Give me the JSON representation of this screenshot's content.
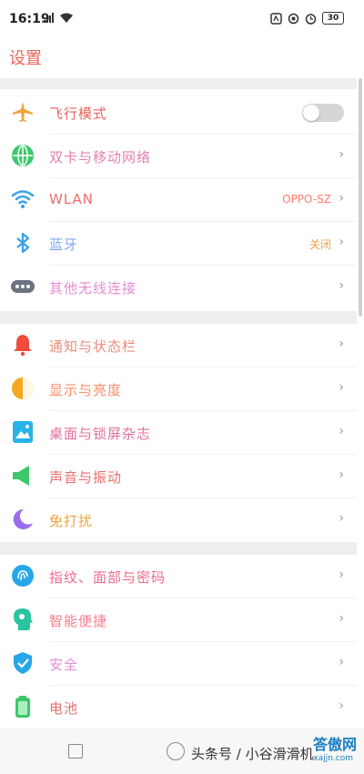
{
  "status": {
    "time": "16:19",
    "battery": "30"
  },
  "title": "设置",
  "rows": {
    "airplane": {
      "label": "飞行模式",
      "label_color": "#e8645a",
      "toggle": "off"
    },
    "dual_sim": {
      "label": "双卡与移动网络",
      "label_color": "#e37fb0"
    },
    "wlan": {
      "label": "WLAN",
      "label_color": "#ee6b6b",
      "value": "OPPO-SZ"
    },
    "bluetooth": {
      "label": "蓝牙",
      "label_color": "#7fa7ee",
      "value": "关闭"
    },
    "other_wireless": {
      "label": "其他无线连接",
      "label_color": "#e58bd4"
    },
    "notifications": {
      "label": "通知与状态栏",
      "label_color": "#f08a7a"
    },
    "display": {
      "label": "显示与亮度",
      "label_color": "#ff8c69"
    },
    "wallpaper": {
      "label": "桌面与锁屏杂志",
      "label_color": "#e46f9a"
    },
    "sound": {
      "label": "声音与振动",
      "label_color": "#ee6b6b"
    },
    "dnd": {
      "label": "免打扰",
      "label_color": "#f0a23c"
    },
    "fingerprint": {
      "label": "指纹、面部与密码",
      "label_color": "#f06b8a"
    },
    "smart": {
      "label": "智能便捷",
      "label_color": "#ff7a8a"
    },
    "security": {
      "label": "安全",
      "label_color": "#e58bd4"
    },
    "battery": {
      "label": "电池",
      "label_color": "#ee6b6b"
    }
  },
  "watermark": {
    "text": "头条号 / 小谷滑滑机",
    "brand": "答傲网",
    "url": "xajjn.com"
  }
}
